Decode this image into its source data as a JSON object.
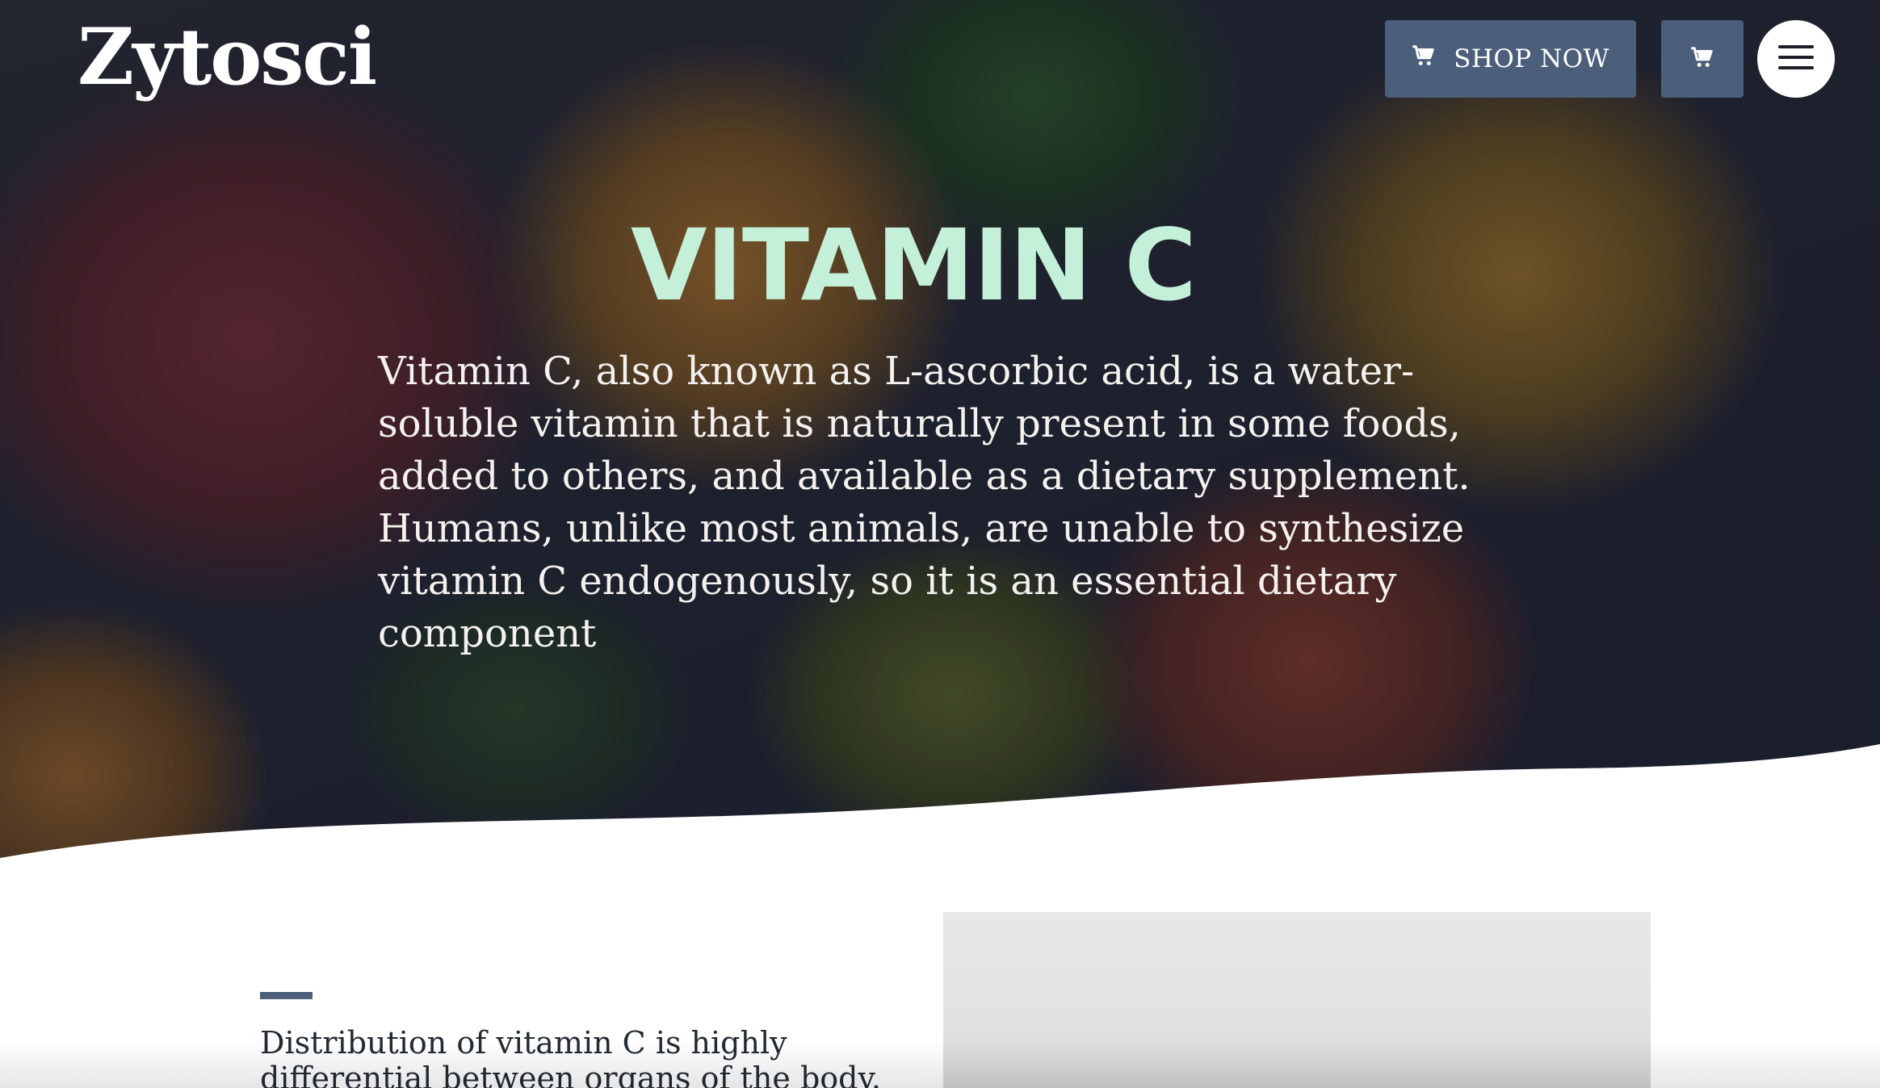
{
  "brand": {
    "name": "Zytosci"
  },
  "header": {
    "shop_label": "SHOP NOW",
    "shop_icon": "cart-icon",
    "cart_icon": "cart-icon",
    "menu_icon": "hamburger-menu-icon"
  },
  "hero": {
    "title": "VITAMIN C",
    "text": "Vitamin C, also known as L-ascorbic acid, is a water-soluble vitamin that is naturally present in some foods, added to others, and available as a dietary supplement. Humans, unlike most animals, are unable to synthesize vitamin C endogenously, so it is an essential dietary component"
  },
  "section": {
    "text": "Distribution of vitamin C is highly differential between organs of the body. Several organs"
  },
  "colors": {
    "accent": "#4b5f7b",
    "title_mint": "#c4efd8",
    "white": "#ffffff",
    "body_text": "#222a33"
  }
}
